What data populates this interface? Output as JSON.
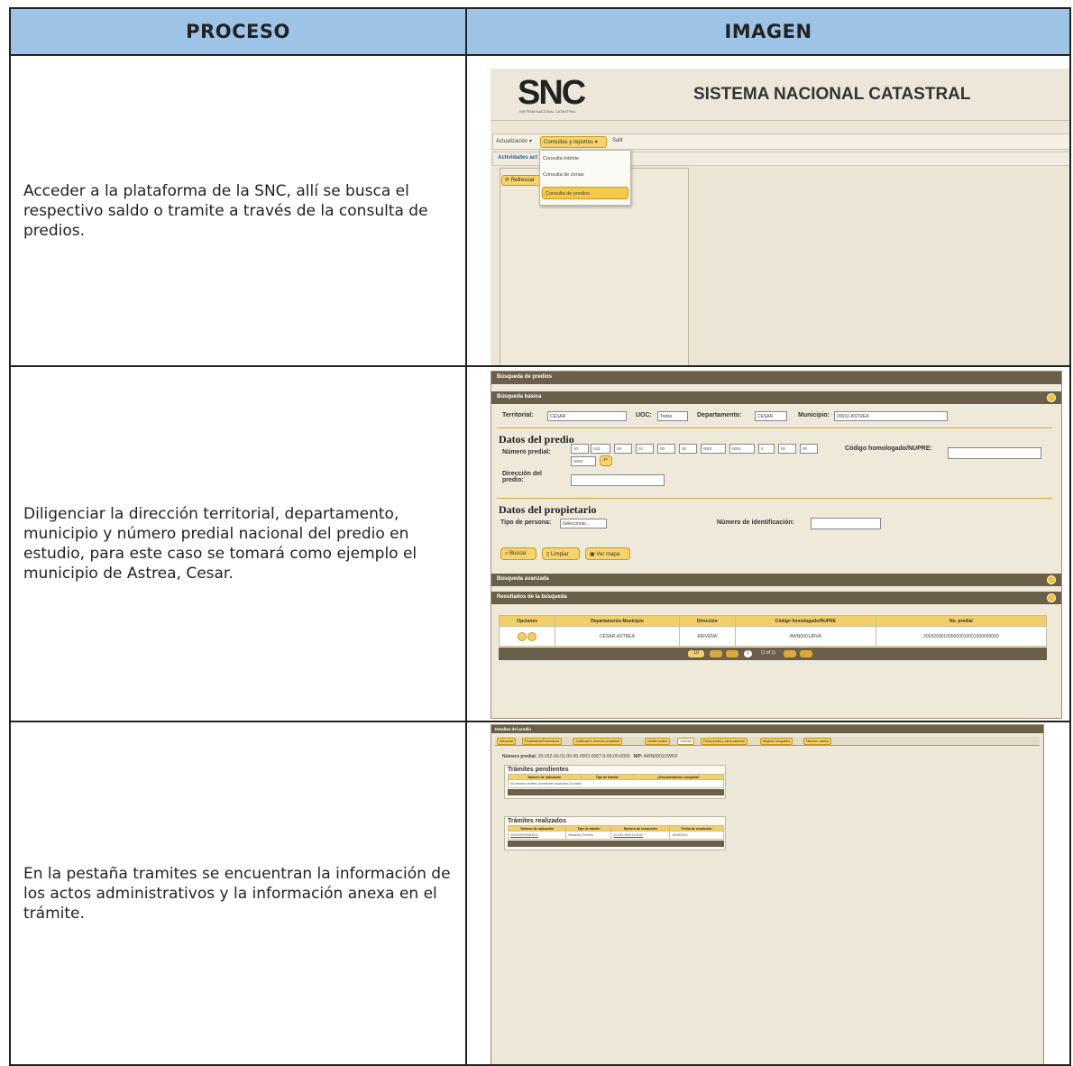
{
  "header": {
    "col1": "PROCESO",
    "col2": "IMAGEN"
  },
  "rows": [
    {
      "text": "Acceder a la plataforma de la SNC, allí se busca el respectivo saldo o tramite a través de la consulta de predios."
    },
    {
      "text": "Diligenciar la dirección territorial, departamento, municipio y número predial nacional del predio en estudio, para este caso se tomará como ejemplo el municipio de Astrea, Cesar."
    },
    {
      "text": "En la pestaña tramites se encuentran la información de los actos administrativos y la información anexa en el trámite."
    }
  ],
  "shot1": {
    "logo": "SNC",
    "logo_sub": "SISTEMA NACIONAL CATASTRAL",
    "title": "SISTEMA NACIONAL CATASTRAL",
    "menu": [
      "Actualización ▾",
      "Consultas y reportes ▾",
      "Salir"
    ],
    "tab": "Actividades act",
    "refresh": "⟳ Refrescar",
    "dropdown": [
      "Consulta trámite",
      "Consulta de zonas",
      "Consulta de predios"
    ]
  },
  "shot2": {
    "title": "Búsqueda de predios",
    "basic": "Búsqueda básica",
    "territorial_label": "Territorial:",
    "territorial": "CESAR",
    "uoc_label": "UOC:",
    "uoc": "Todas",
    "dep_label": "Departamento:",
    "dep": "CESAR",
    "mun_label": "Municipio:",
    "mun": "20032-ASTREA",
    "datos_predio": "Datos del predio",
    "numero_label": "Número predial:",
    "numero": [
      "20",
      "032",
      "00",
      "01",
      "00",
      "00",
      "0001",
      "0001",
      "0",
      "00",
      "00",
      "0000"
    ],
    "codigo_label": "Código homologado/NUPRE:",
    "direccion_label": "Dirección del predio:",
    "datos_prop": "Datos del propietario",
    "tipo_label": "Tipo de persona:",
    "tipo": "Seleccionar...",
    "ident_label": "Número de identificación:",
    "buttons": [
      "Buscar",
      "Limpiar",
      "Ver mapa"
    ],
    "avanzada": "Búsqueda avanzada",
    "resultados": "Resultados de la búsqueda",
    "cols": [
      "Opciones",
      "Departamento-Municipio",
      "Dirección",
      "Código homologado/NUPRE",
      "No. predial"
    ],
    "row": [
      "",
      "CESAR-ASTREA",
      "ARIVENA",
      "AWN0001JRVA",
      "200320001000000010001000000000"
    ],
    "pager": {
      "size": "10",
      "page": "1",
      "of": "(1 of 1)"
    }
  },
  "shot3": {
    "title": "Detalles del predio",
    "tabs": [
      "Ubicación",
      "Propietarios/Poseedores",
      "Justificación derecho propiedad",
      "Detalle avalúo",
      "Trámites",
      "Ficha predial y carta catastral",
      "Registro fotográfico",
      "Histórico avalúo"
    ],
    "numero_label": "Número predial:",
    "numero": "20-032-00-01-00-00-0002-0067-0-00-00-0000",
    "nip_label": "NIP:",
    "nip": "AWN0001OWRF",
    "pend_title": "Trámites pendientes",
    "pend_cols": [
      "Número de radicación",
      "Tipo de trámite",
      "¿Documentación completa?"
    ],
    "pend_empty": "No existen trámites pendientes asociados al predio",
    "real_title": "Trámites realizados",
    "real_cols": [
      "Número de radicación",
      "Tipo de trámite",
      "Número de resolución",
      "Fecha de resolución"
    ],
    "real_row": [
      "2003200000063022",
      "Mutación Primera",
      "20-032-000013-2022",
      "18/05/2022"
    ]
  }
}
